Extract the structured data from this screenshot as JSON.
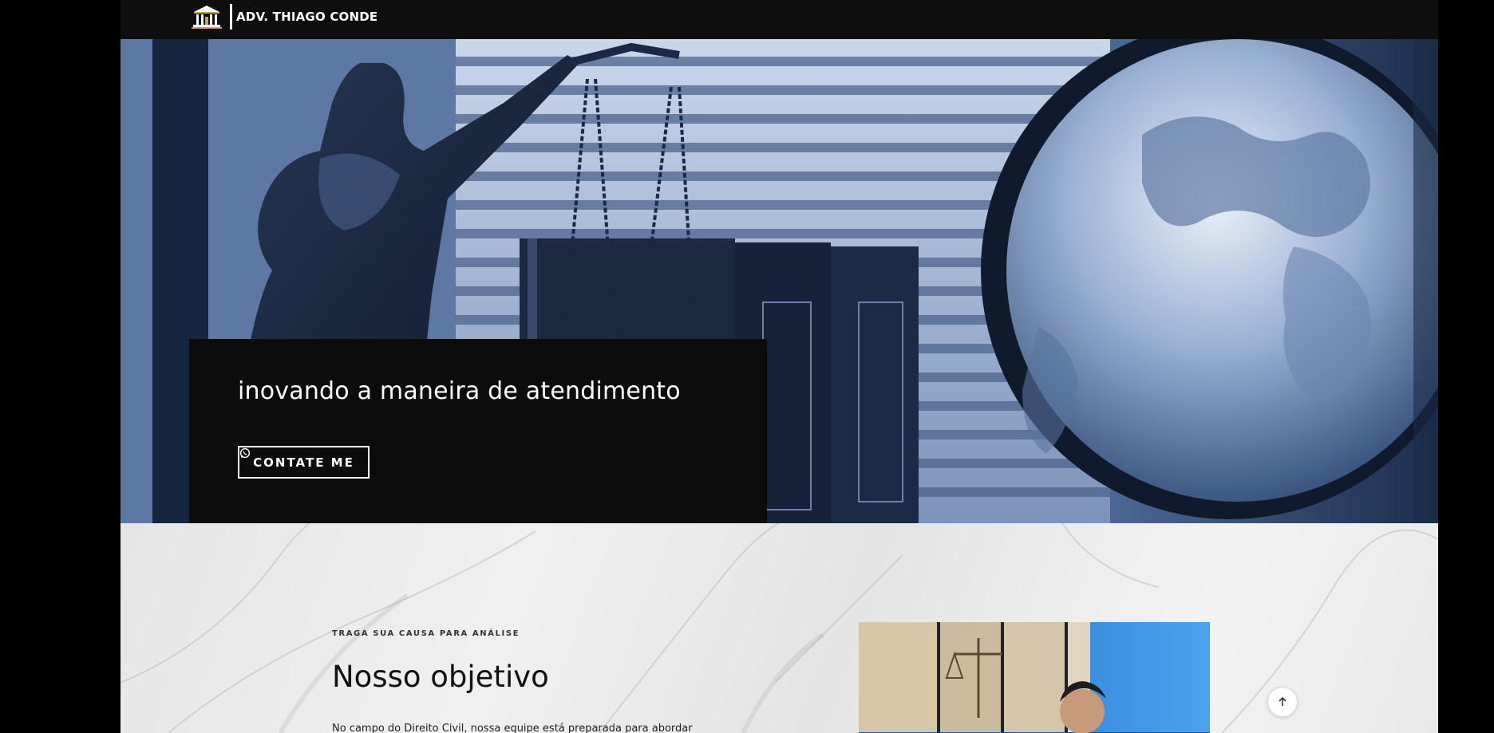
{
  "header": {
    "brand": "ADV. THIAGO CONDE",
    "logo_icon": "courthouse-logo-icon"
  },
  "hero": {
    "title": "inovando a maneira de atendimento",
    "cta_label": "CONTATE ME",
    "cta_icon": "whatsapp-icon",
    "background": "scales-of-justice-globe-photo"
  },
  "about": {
    "eyebrow": "TRAGA SUA CAUSA PARA ANÁLISE",
    "title": "Nosso objetivo",
    "text": "No campo do Direito Civil, nossa equipe está preparada para abordar",
    "photo": "lawyer-office-photo"
  },
  "scroll_top": {
    "icon": "arrow-up-icon"
  },
  "colors": {
    "header_bg": "#0e0e0e",
    "hero_card_bg": "#0c0c0c",
    "accent_blue": "#2f7fd8"
  }
}
